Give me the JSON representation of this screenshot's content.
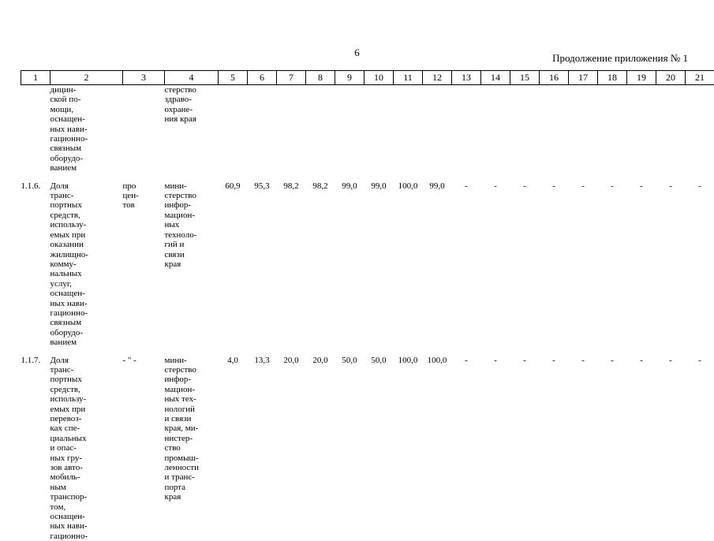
{
  "page": {
    "number": "6",
    "continuation_label": "Продолжение приложения № 1"
  },
  "table": {
    "column_numbers": [
      "1",
      "2",
      "3",
      "4",
      "5",
      "6",
      "7",
      "8",
      "9",
      "10",
      "11",
      "12",
      "13",
      "14",
      "15",
      "16",
      "17",
      "18",
      "19",
      "20",
      "21"
    ],
    "rows": [
      {
        "index": "",
        "name": "дицин-\nской по-\nмощи,\nоснащен-\nных нави-\nгационно-\nсвязным\nоборудо-\nванием",
        "unit": "",
        "responsible": "стерство\nздраво-\nохране-\nния края",
        "values": [
          "",
          "",
          "",
          "",
          "",
          "",
          "",
          ""
        ],
        "extra": [
          "",
          "",
          "",
          "",
          "",
          "",
          "",
          "",
          ""
        ]
      },
      {
        "index": "1.1.6.",
        "name": "Доля\nтранс-\nпортных\nсредств,\nиспользу-\nемых при\nоказании\nжилищно-\nкомму-\nнальных\nуслуг,\nоснащен-\nных нави-\nгационно-\nсвязным\nоборудо-\nванием",
        "unit": "про\nцен-\nтов",
        "responsible": "мини-\nстерство\nинфор-\nмацион-\nных\nтехноло-\nгий и\nсвязи\nкрая",
        "values": [
          "60,9",
          "95,3",
          "98,2",
          "98,2",
          "99,0",
          "99,0",
          "100,0",
          "99,0"
        ],
        "extra": [
          "-",
          "-",
          "-",
          "-",
          "-",
          "-",
          "-",
          "-",
          "-"
        ]
      },
      {
        "index": "1.1.7.",
        "name": "Доля\nтранс-\nпортных\nсредств,\nиспользу-\nемых при\nперевоз-\nках спе-\nциальных\nи опас-\nных гру-\nзов авто-\nмобиль-\nным\nтранспор-\nтом,\nоснащен-\nных нави-\nгационно-",
        "unit": "- \" -",
        "responsible": "мини-\nстерство\nинфор-\nмацион-\nных тех-\nнологий\nи связи\nкрая, ми-\nнистер-\nство\nпромыш-\nленности\nи транс-\nпорта\nкрая",
        "values": [
          "4,0",
          "13,3",
          "20,0",
          "20,0",
          "50,0",
          "50,0",
          "100,0",
          "100,0"
        ],
        "extra": [
          "-",
          "-",
          "-",
          "-",
          "-",
          "-",
          "-",
          "-",
          "-"
        ]
      }
    ]
  }
}
